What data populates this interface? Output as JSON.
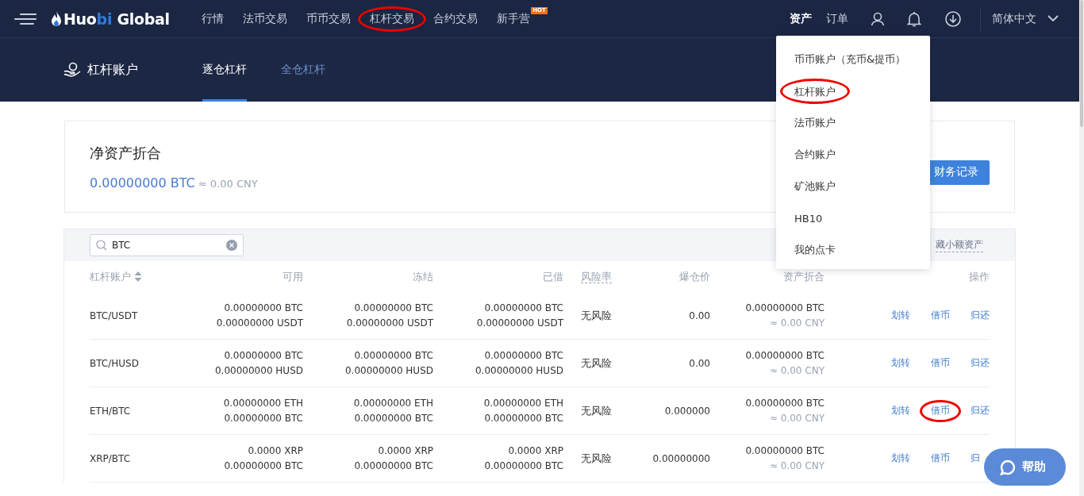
{
  "logo": {
    "parts": [
      {
        "text": "Huo",
        "accent": false
      },
      {
        "text": "bi",
        "accent": true
      },
      {
        "text": " Global",
        "accent": false
      }
    ]
  },
  "nav": [
    {
      "label": "行情",
      "circled": false
    },
    {
      "label": "法币交易",
      "circled": false
    },
    {
      "label": "币币交易",
      "circled": false
    },
    {
      "label": "杠杆交易",
      "circled": true
    },
    {
      "label": "合约交易",
      "circled": false
    },
    {
      "label": "新手营",
      "circled": false,
      "badge": "HOT"
    }
  ],
  "nav_right": [
    {
      "label": "资产",
      "selected": true
    },
    {
      "label": "订单",
      "selected": false
    }
  ],
  "language": "简体中文",
  "subheader": {
    "title": "杠杆账户",
    "tabs": [
      {
        "label": "逐仓杠杆",
        "selected": true
      },
      {
        "label": "全仓杠杆",
        "selected": false
      }
    ]
  },
  "summary": {
    "title": "净资产折合",
    "value": "0.00000000 BTC",
    "approx": "≈ 0.00 CNY",
    "button": "财务记录"
  },
  "search": {
    "value": "BTC"
  },
  "hide_small": "藏小额资产",
  "table": {
    "columns": [
      {
        "label": "杠杆账户",
        "sortable": true,
        "dashed": false
      },
      {
        "label": "可用",
        "dashed": false
      },
      {
        "label": "冻结",
        "dashed": false
      },
      {
        "label": "已借",
        "dashed": false
      },
      {
        "label": "风险率",
        "dashed": true
      },
      {
        "label": "爆仓价",
        "dashed": false
      },
      {
        "label": "资产折合",
        "dashed": false
      },
      {
        "label": "操作",
        "dashed": false
      }
    ],
    "rows": [
      {
        "pair": "BTC/USDT",
        "available": [
          "0.00000000 BTC",
          "0.00000000 USDT"
        ],
        "frozen": [
          "0.00000000 BTC",
          "0.00000000 USDT"
        ],
        "borrowed": [
          "0.00000000 BTC",
          "0.00000000 USDT"
        ],
        "risk": "无风险",
        "liquidation": "0.00",
        "value": "0.00000000 BTC",
        "value_cny": "≈ 0.00 CNY",
        "actions": [
          {
            "label": "划转",
            "circled": false
          },
          {
            "label": "借币",
            "circled": false
          },
          {
            "label": "归还",
            "circled": false
          }
        ]
      },
      {
        "pair": "BTC/HUSD",
        "available": [
          "0.00000000 BTC",
          "0.00000000 HUSD"
        ],
        "frozen": [
          "0.00000000 BTC",
          "0.00000000 HUSD"
        ],
        "borrowed": [
          "0.00000000 BTC",
          "0.00000000 HUSD"
        ],
        "risk": "无风险",
        "liquidation": "0.00",
        "value": "0.00000000 BTC",
        "value_cny": "≈ 0.00 CNY",
        "actions": [
          {
            "label": "划转",
            "circled": false
          },
          {
            "label": "借币",
            "circled": false
          },
          {
            "label": "归还",
            "circled": false
          }
        ]
      },
      {
        "pair": "ETH/BTC",
        "available": [
          "0.00000000 ETH",
          "0.00000000 BTC"
        ],
        "frozen": [
          "0.00000000 ETH",
          "0.00000000 BTC"
        ],
        "borrowed": [
          "0.00000000 ETH",
          "0.00000000 BTC"
        ],
        "risk": "无风险",
        "liquidation": "0.000000",
        "value": "0.00000000 BTC",
        "value_cny": "≈ 0.00 CNY",
        "actions": [
          {
            "label": "划转",
            "circled": false
          },
          {
            "label": "借币",
            "circled": true
          },
          {
            "label": "归还",
            "circled": false
          }
        ]
      },
      {
        "pair": "XRP/BTC",
        "available": [
          "0.0000 XRP",
          "0.00000000 BTC"
        ],
        "frozen": [
          "0.0000 XRP",
          "0.00000000 BTC"
        ],
        "borrowed": [
          "0.0000 XRP",
          "0.00000000 BTC"
        ],
        "risk": "无风险",
        "liquidation": "0.00000000",
        "value": "0.00000000 BTC",
        "value_cny": "≈ 0.00 CNY",
        "actions": [
          {
            "label": "划转",
            "circled": false
          },
          {
            "label": "借币",
            "circled": false
          },
          {
            "label": "归",
            "circled": false
          }
        ]
      }
    ]
  },
  "assets_menu": [
    {
      "label": "币币账户（充币&提币）",
      "circled": false
    },
    {
      "label": "杠杆账户",
      "circled": true
    },
    {
      "label": "法币账户",
      "circled": false
    },
    {
      "label": "合约账户",
      "circled": false
    },
    {
      "label": "矿池账户",
      "circled": false
    },
    {
      "label": "HB10",
      "circled": false
    },
    {
      "label": "我的点卡",
      "circled": false
    }
  ],
  "help": "帮助"
}
